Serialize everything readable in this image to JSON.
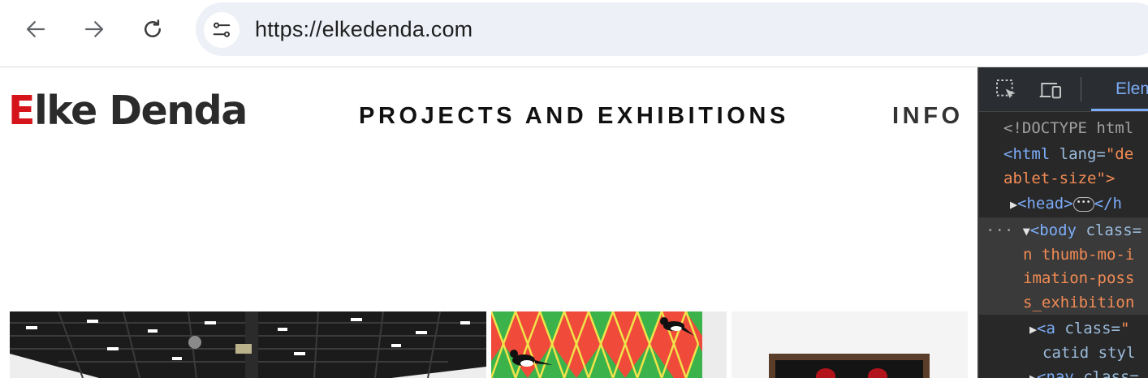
{
  "browser": {
    "url": "https://elkedenda.com",
    "icons": {
      "back": "arrow-left-icon",
      "forward": "arrow-right-icon",
      "reload": "reload-icon",
      "site_info": "tune-icon"
    }
  },
  "page": {
    "logo": {
      "first_letter": "E",
      "rest": "lke Denda"
    },
    "nav": [
      {
        "label": "PROJECTS AND EXHIBITIONS"
      },
      {
        "label": "INFO"
      }
    ],
    "colors": {
      "logo_accent": "#d6141b",
      "text": "#111111"
    }
  },
  "devtools": {
    "active_tab": "Elem",
    "icons": {
      "inspect": "inspect-element-icon",
      "device": "device-toolbar-icon"
    },
    "dom_lines": [
      {
        "text": "<!DOCTYPE html"
      },
      {
        "tag_open": "<html ",
        "attr": "lang=",
        "val": "\"de"
      },
      {
        "val": "ablet-size\">"
      },
      {
        "tag": "<head>",
        "after": "</h"
      },
      {
        "tag_open": "<body ",
        "attr": "class="
      },
      {
        "val": "n thumb-mo-i"
      },
      {
        "val": "imation-poss"
      },
      {
        "val": "s_exhibition"
      },
      {
        "tag_open": "<a ",
        "attr": "class=",
        "val": "\""
      },
      {
        "attr": "catid styl"
      },
      {
        "tag_open": "<nav ",
        "attr": "class="
      }
    ]
  }
}
